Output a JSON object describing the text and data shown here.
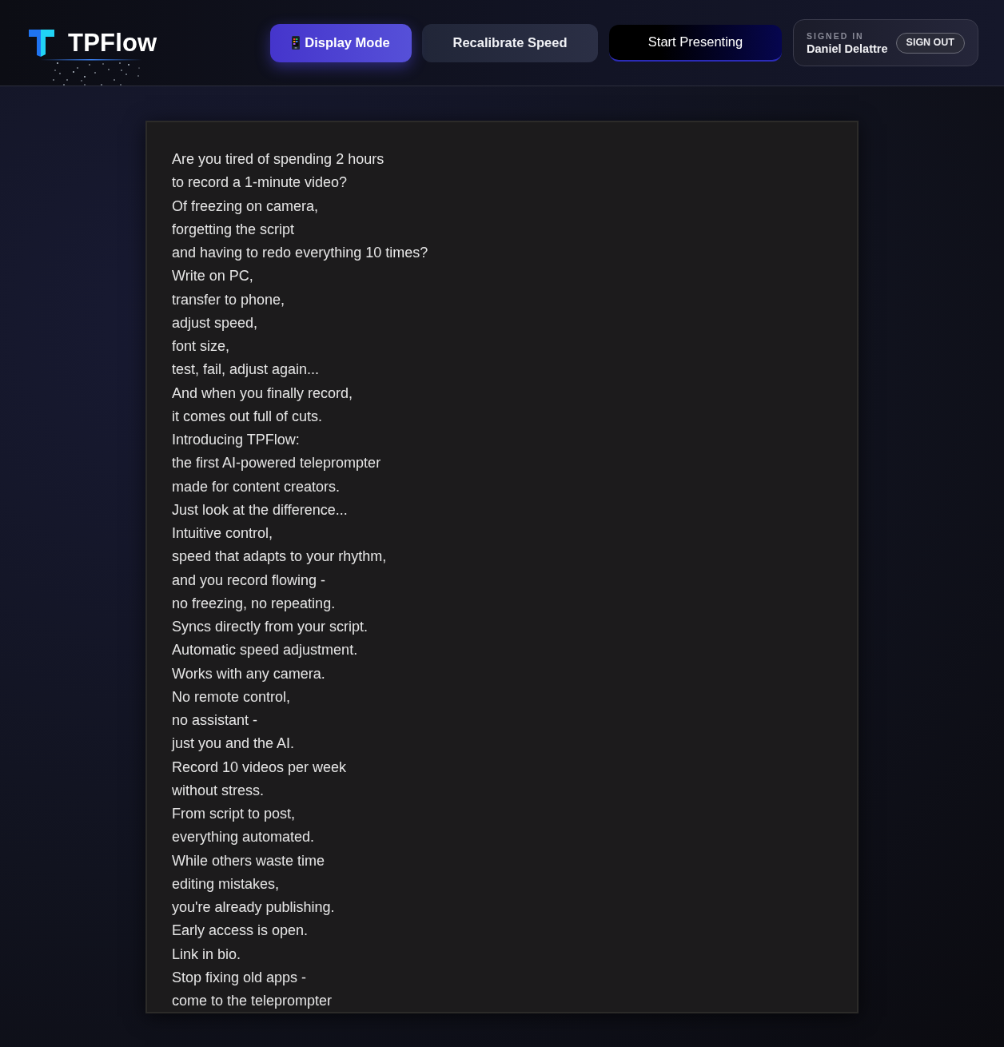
{
  "header": {
    "logo": {
      "text": "TPFlow"
    },
    "actions": [
      {
        "kind": "mode",
        "label": "Display Mode"
      },
      {
        "kind": "action",
        "label": "Recalibrate Speed"
      },
      {
        "kind": "present",
        "label": "Start Presenting"
      }
    ],
    "account": {
      "status_label": "SIGNED IN",
      "user_name": "Daniel Delattre",
      "sign_out_label": "SIGN OUT"
    }
  },
  "script_editor": {
    "lines": [
      "Are you tired of spending 2 hours",
      "to record a 1-minute video?",
      "Of freezing on camera,",
      "forgetting the script",
      "and having to redo everything 10 times?",
      "Write on PC,",
      "transfer to phone,",
      "adjust speed,",
      "font size,",
      "test, fail, adjust again...",
      "And when you finally record,",
      "it comes out full of cuts.",
      "Introducing TPFlow:",
      "the first AI-powered teleprompter",
      "made for content creators.",
      "Just look at the difference...",
      "Intuitive control,",
      "speed that adapts to your rhythm,",
      "and you record flowing -",
      "no freezing, no repeating.",
      "Syncs directly from your script.",
      "Automatic speed adjustment.",
      "Works with any camera.",
      "No remote control,",
      "no assistant -",
      "just you and the AI.",
      "Record 10 videos per week",
      "without stress.",
      "From script to post,",
      "everything automated.",
      "While others waste time",
      "editing mistakes,",
      "you're already publishing.",
      "Early access is open.",
      "Link in bio.",
      "Stop fixing old apps -",
      "come to the teleprompter"
    ]
  }
}
